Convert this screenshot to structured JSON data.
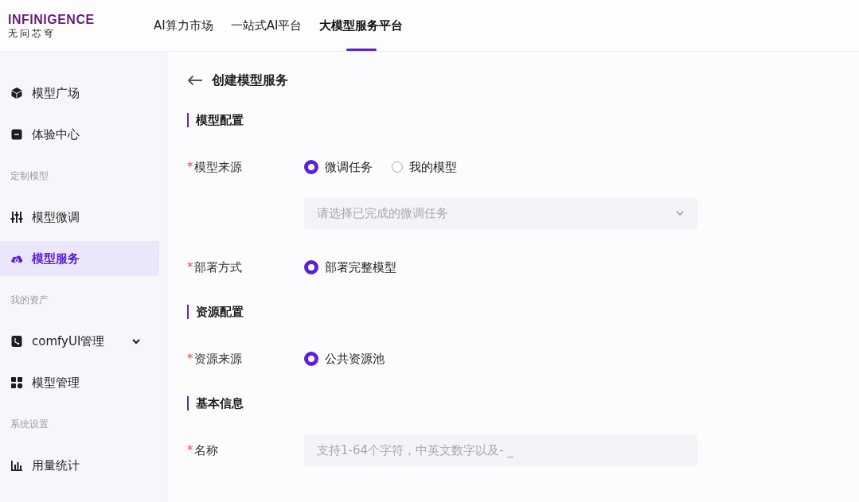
{
  "brand": {
    "wordmark": "INFINIGENCE",
    "subtitle": "无问芯穹"
  },
  "nav": [
    {
      "label": "AI算力市场",
      "selected": false
    },
    {
      "label": "一站式AI平台",
      "selected": false
    },
    {
      "label": "大模型服务平台",
      "selected": true
    }
  ],
  "sidebar": {
    "items": [
      {
        "kind": "item",
        "label": "模型广场",
        "selected": false
      },
      {
        "kind": "item",
        "label": "体验中心",
        "selected": false
      },
      {
        "kind": "group",
        "label": "定制模型"
      },
      {
        "kind": "item",
        "label": "模型微调",
        "selected": false
      },
      {
        "kind": "item",
        "label": "模型服务",
        "selected": true
      },
      {
        "kind": "group",
        "label": "我的资产"
      },
      {
        "kind": "item",
        "label": "comfyUI管理",
        "selected": false,
        "expanded": false
      },
      {
        "kind": "item",
        "label": "模型管理",
        "selected": false
      },
      {
        "kind": "group",
        "label": "系统设置"
      },
      {
        "kind": "item",
        "label": "用量统计",
        "selected": false
      }
    ]
  },
  "page": {
    "title": "创建模型服务"
  },
  "sections": [
    {
      "title": "模型配置",
      "fields": [
        {
          "kind": "radio",
          "mark": "*",
          "label": "模型来源",
          "options": [
            {
              "label": "微调任务",
              "selected": true
            },
            {
              "label": "我的模型",
              "selected": false
            }
          ]
        },
        {
          "kind": "select",
          "placeholder": "请选择已完成的微调任务"
        },
        {
          "kind": "radio",
          "mark": "*",
          "label": "部署方式",
          "options": [
            {
              "label": "部署完整模型",
              "selected": true
            }
          ]
        }
      ]
    },
    {
      "title": "资源配置",
      "fields": [
        {
          "kind": "radio",
          "mark": "*",
          "label": "资源来源",
          "options": [
            {
              "label": "公共资源池",
              "selected": true
            }
          ]
        }
      ]
    },
    {
      "title": "基本信息",
      "fields": [
        {
          "kind": "input",
          "mark": "*",
          "label": "名称",
          "placeholder": "支持1-64个字符，中英文数字以及- _"
        }
      ]
    }
  ]
}
